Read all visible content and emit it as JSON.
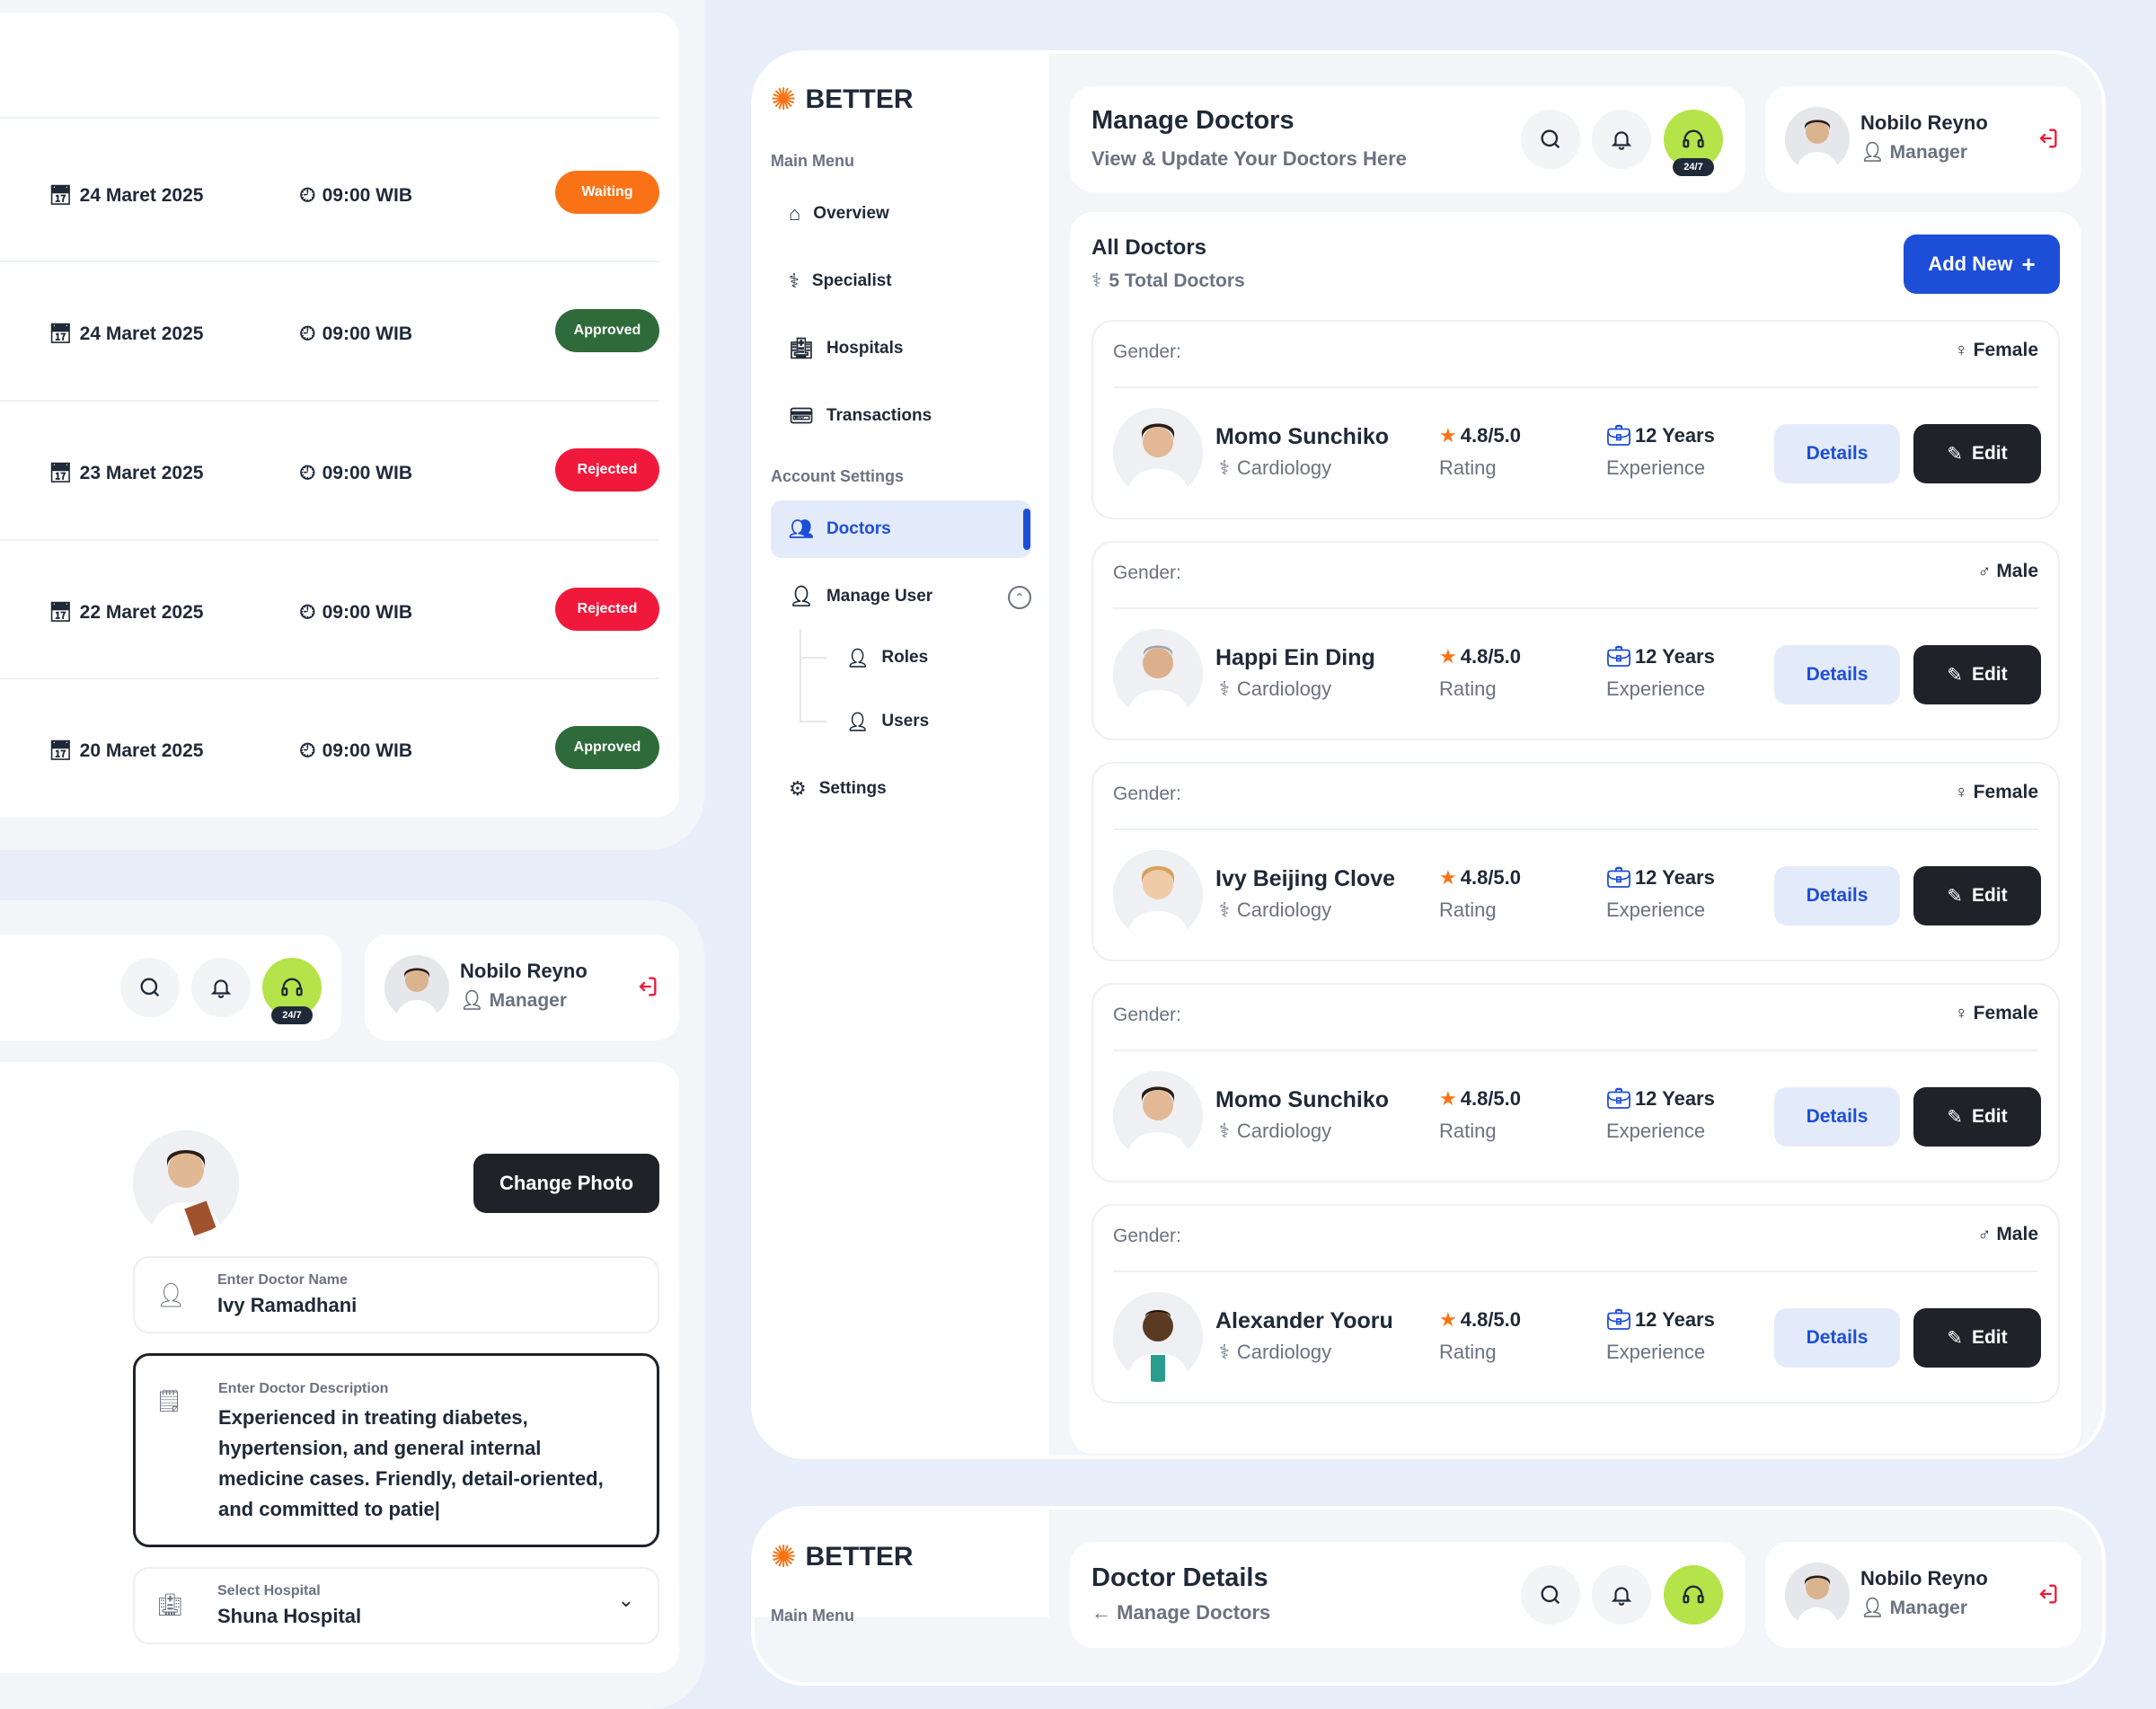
{
  "schedule": {
    "rows": [
      {
        "date": "24 Maret 2025",
        "time": "09:00 WIB",
        "status": "Waiting",
        "color": "#f97316"
      },
      {
        "date": "24 Maret 2025",
        "time": "09:00 WIB",
        "status": "Approved",
        "color": "#2f6b3a"
      },
      {
        "date": "23 Maret 2025",
        "time": "09:00 WIB",
        "status": "Rejected",
        "color": "#f0193c"
      },
      {
        "date": "22 Maret 2025",
        "time": "09:00 WIB",
        "status": "Rejected",
        "color": "#f0193c"
      },
      {
        "date": "20 Maret 2025",
        "time": "09:00 WIB",
        "status": "Approved",
        "color": "#2f6b3a"
      }
    ]
  },
  "user": {
    "name": "Nobilo Reyno",
    "role": "Manager"
  },
  "badge": "24/7",
  "brand": {
    "name": "BETTER",
    "accent": "#f97316",
    "primary": "#1d4ed8"
  },
  "sidebar": {
    "main_menu_label": "Main Menu",
    "items": [
      {
        "label": "Overview",
        "icon": "home-icon"
      },
      {
        "label": "Specialist",
        "icon": "stethoscope-icon"
      },
      {
        "label": "Hospitals",
        "icon": "hospital-icon"
      },
      {
        "label": "Transactions",
        "icon": "wallet-icon"
      }
    ],
    "account_label": "Account Settings",
    "doctors_label": "Doctors",
    "manage_user_label": "Manage User",
    "sub_items": [
      {
        "label": "Roles"
      },
      {
        "label": "Users"
      }
    ],
    "settings_label": "Settings"
  },
  "header": {
    "title": "Manage Doctors",
    "subtitle": "View & Update Your Doctors Here"
  },
  "list": {
    "title": "All Doctors",
    "count_text": "5 Total Doctors",
    "add_new_label": "Add New",
    "gender_label": "Gender:",
    "rating_label": "Rating",
    "exp_label": "Experience",
    "details_label": "Details",
    "edit_label": "Edit",
    "doctors": [
      {
        "name": "Momo Sunchiko",
        "specialty": "Cardiology",
        "gender": "Female",
        "rating": "4.8/5.0",
        "experience": "12 Years"
      },
      {
        "name": "Happi Ein Ding",
        "specialty": "Cardiology",
        "gender": "Male",
        "rating": "4.8/5.0",
        "experience": "12 Years"
      },
      {
        "name": "Ivy Beijing Clove",
        "specialty": "Cardiology",
        "gender": "Female",
        "rating": "4.8/5.0",
        "experience": "12 Years"
      },
      {
        "name": "Momo Sunchiko",
        "specialty": "Cardiology",
        "gender": "Female",
        "rating": "4.8/5.0",
        "experience": "12 Years"
      },
      {
        "name": "Alexander Yooru",
        "specialty": "Cardiology",
        "gender": "Male",
        "rating": "4.8/5.0",
        "experience": "12 Years"
      }
    ]
  },
  "form": {
    "change_photo_label": "Change Photo",
    "name_label": "Enter Doctor Name",
    "name_value": "Ivy Ramadhani",
    "desc_label": "Enter Doctor Description",
    "desc_value": "Experienced in treating diabetes, hypertension, and general internal medicine cases. Friendly, detail-oriented, and committed to patie|",
    "hospital_label": "Select Hospital",
    "hospital_value": "Shuna Hospital"
  },
  "bottom": {
    "title": "Doctor Details",
    "back_label": "← Manage Doctors",
    "main_menu_label": "Main Menu"
  }
}
